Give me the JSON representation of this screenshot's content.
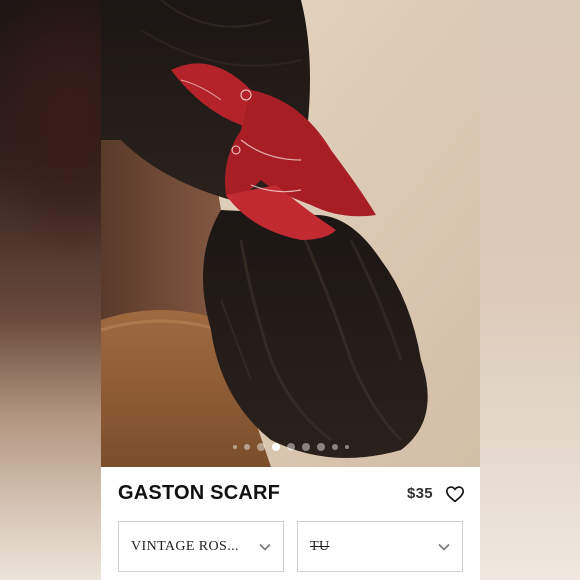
{
  "product": {
    "name": "GASTON SCARF",
    "price": "$35"
  },
  "options": {
    "color_value": "VINTAGE ROS...",
    "size_value": "TU"
  },
  "carousel": {
    "total_slides": 9,
    "active_index": 3
  },
  "icons": {
    "favorite": "heart-outline-icon",
    "dropdown": "chevron-down-icon"
  },
  "colors": {
    "scarf": "#b5232a",
    "card_background": "#ffffff",
    "text": "#111111"
  }
}
